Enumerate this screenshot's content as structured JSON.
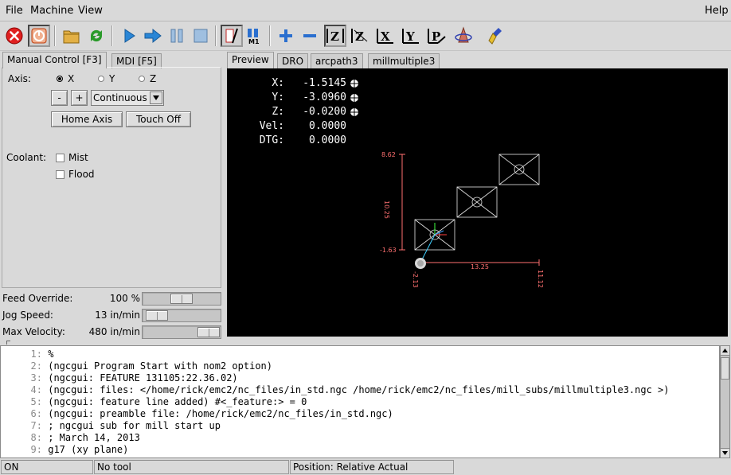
{
  "menubar": {
    "file": "File",
    "machine": "Machine",
    "view": "View",
    "help": "Help"
  },
  "toolbar": {
    "icons": [
      "estop-icon",
      "machine-power-icon",
      "open-file-icon",
      "reload-icon",
      "run-icon",
      "step-icon",
      "pause-icon",
      "stop-icon",
      "block-delete-icon",
      "optional-stop-icon",
      "zoom-in-icon",
      "zoom-out-icon",
      "view-z-icon",
      "view-z2-icon",
      "view-x-icon",
      "view-y-icon",
      "view-p-icon",
      "rotate-icon",
      "clear-plot-icon"
    ],
    "colors": {
      "estop": "#e02020",
      "run": "#2a86d6",
      "zoom": "#2a6fcf",
      "reload": "#2a9a2a"
    }
  },
  "left_tabs": [
    "Manual Control [F3]",
    "MDI [F5]"
  ],
  "manual": {
    "axis_label": "Axis:",
    "axes": [
      "X",
      "Y",
      "Z"
    ],
    "selected_axis": "X",
    "minus": "-",
    "plus": "+",
    "jog_mode": "Continuous",
    "home_axis": "Home Axis",
    "touch_off": "Touch Off",
    "coolant_label": "Coolant:",
    "mist": "Mist",
    "flood": "Flood"
  },
  "overrides": {
    "feed_label": "Feed Override:",
    "feed_value": "100 %",
    "feed_fraction": 0.5,
    "jog_label": "Jog Speed:",
    "jog_value": "13 in/min",
    "jog_fraction": 0.05,
    "maxvel_label": "Max Velocity:",
    "maxvel_value": "480 in/min",
    "maxvel_fraction": 1.0
  },
  "right_tabs": [
    "Preview",
    "DRO",
    "arcpath3",
    "millmultiple3"
  ],
  "dro": [
    {
      "label": " X:",
      "value": "-1.5145",
      "marker": true
    },
    {
      "label": " Y:",
      "value": "-3.0960",
      "marker": true
    },
    {
      "label": " Z:",
      "value": "-0.0200",
      "marker": true
    },
    {
      "label": "Vel:",
      "value": " 0.0000",
      "marker": false
    },
    {
      "label": "DTG:",
      "value": " 0.0000",
      "marker": false
    }
  ],
  "plot": {
    "y_top": "8.62",
    "y_size": "10.25",
    "y_bottom": "-1.63",
    "x_left": "-2.13",
    "x_size": "13.25",
    "x_right": "11.12",
    "dim_color": "#ff7070",
    "line_color": "#e8e8e8"
  },
  "gcode": [
    {
      "n": "1:",
      "text": "%"
    },
    {
      "n": "2:",
      "text": "(ngcgui Program Start with nom2 option)"
    },
    {
      "n": "3:",
      "text": "(ngcgui: FEATURE 131105:22.36.02)"
    },
    {
      "n": "4:",
      "text": "(ngcgui: files: </home/rick/emc2/nc_files/in_std.ngc /home/rick/emc2/nc_files/mill_subs/millmultiple3.ngc >)"
    },
    {
      "n": "5:",
      "text": "(ngcgui: feature line added) #<_feature:> = 0"
    },
    {
      "n": "6:",
      "text": "(ngcgui: preamble file: /home/rick/emc2/nc_files/in_std.ngc)"
    },
    {
      "n": "7:",
      "text": "; ngcgui sub for mill start up"
    },
    {
      "n": "8:",
      "text": "; March 14, 2013"
    },
    {
      "n": "9:",
      "text": "g17 (xy plane)"
    }
  ],
  "status": {
    "machine": "ON",
    "tool": "No tool",
    "position": "Position: Relative Actual"
  }
}
